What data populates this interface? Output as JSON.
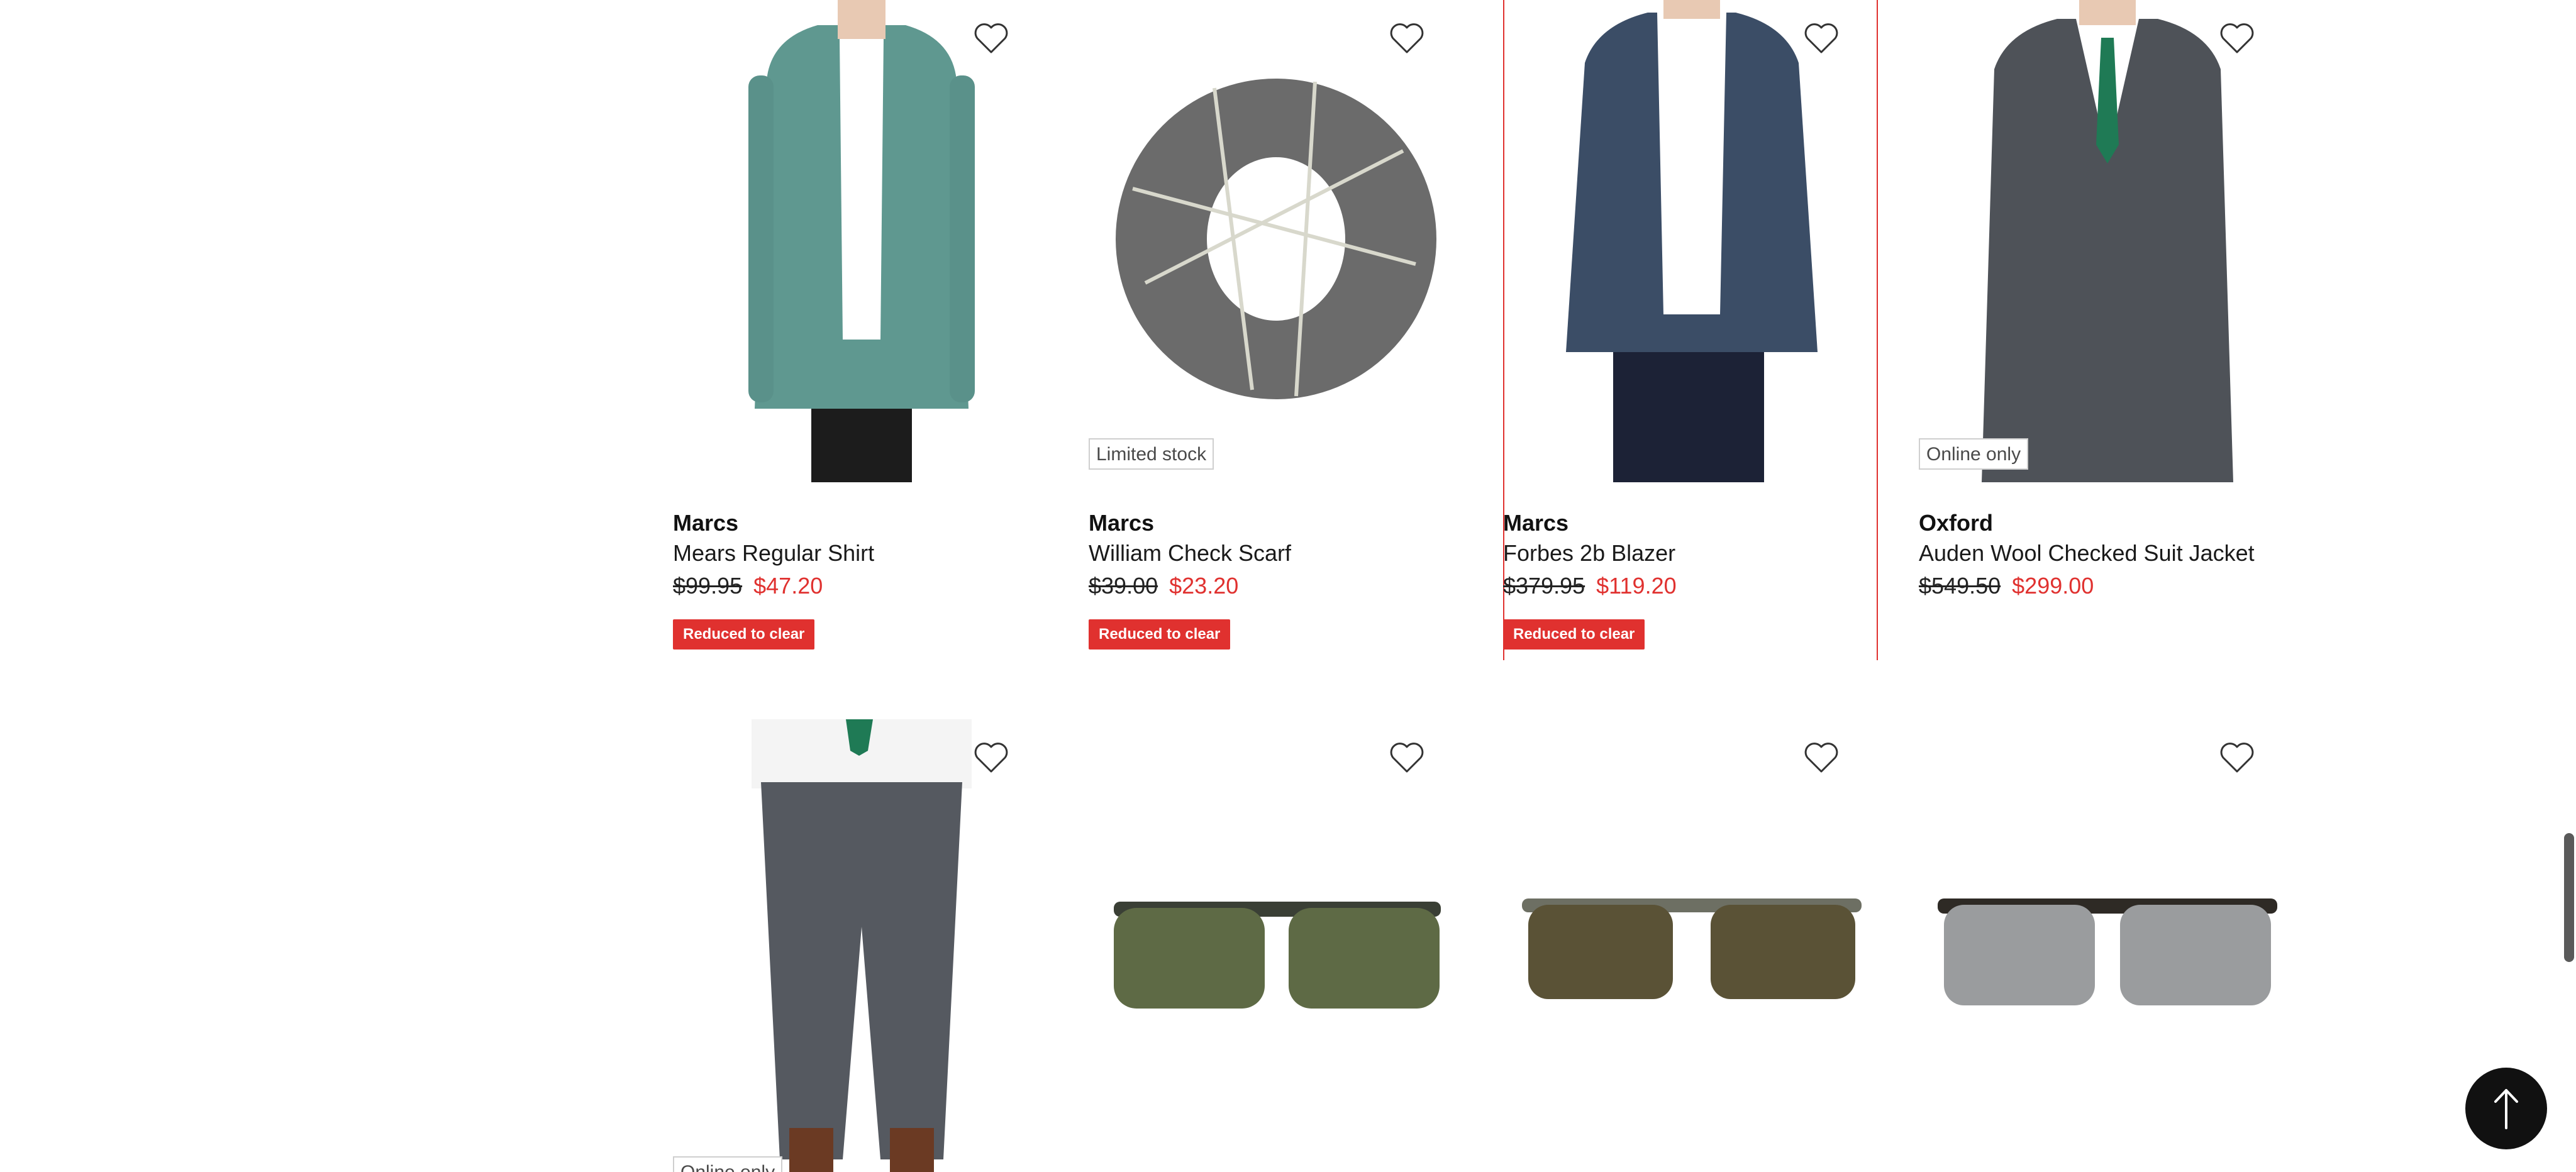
{
  "products": [
    {
      "brand": "Marcs",
      "name": "Mears Regular Shirt",
      "was": "$99.95",
      "now": "$47.20",
      "tag": "",
      "badge": "Reduced to clear",
      "image": "model-in-green-shirt"
    },
    {
      "brand": "Marcs",
      "name": "William Check Scarf",
      "was": "$39.00",
      "now": "$23.20",
      "tag": "Limited stock",
      "badge": "Reduced to clear",
      "image": "grey-check-scarf"
    },
    {
      "brand": "Marcs",
      "name": "Forbes 2b Blazer",
      "was": "$379.95",
      "now": "$119.20",
      "tag": "",
      "badge": "Reduced to clear",
      "image": "model-in-navy-blazer"
    },
    {
      "brand": "Oxford",
      "name": "Auden Wool Checked Suit Jacket",
      "was": "$549.50",
      "now": "$299.00",
      "tag": "Online only",
      "badge": "",
      "image": "model-in-grey-suit"
    },
    {
      "tag": "Online only",
      "image": "model-in-grey-trousers"
    },
    {
      "tag": "",
      "image": "green-lens-sunglasses"
    },
    {
      "tag": "",
      "image": "brown-lens-sunglasses"
    },
    {
      "tag": "",
      "image": "silver-lens-sunglasses"
    }
  ],
  "icons": {
    "wishlist": "heart-outline-icon",
    "back_to_top": "arrow-up-icon"
  },
  "colors": {
    "sale": "#e0312f",
    "text": "#111111",
    "button": "#111111"
  }
}
